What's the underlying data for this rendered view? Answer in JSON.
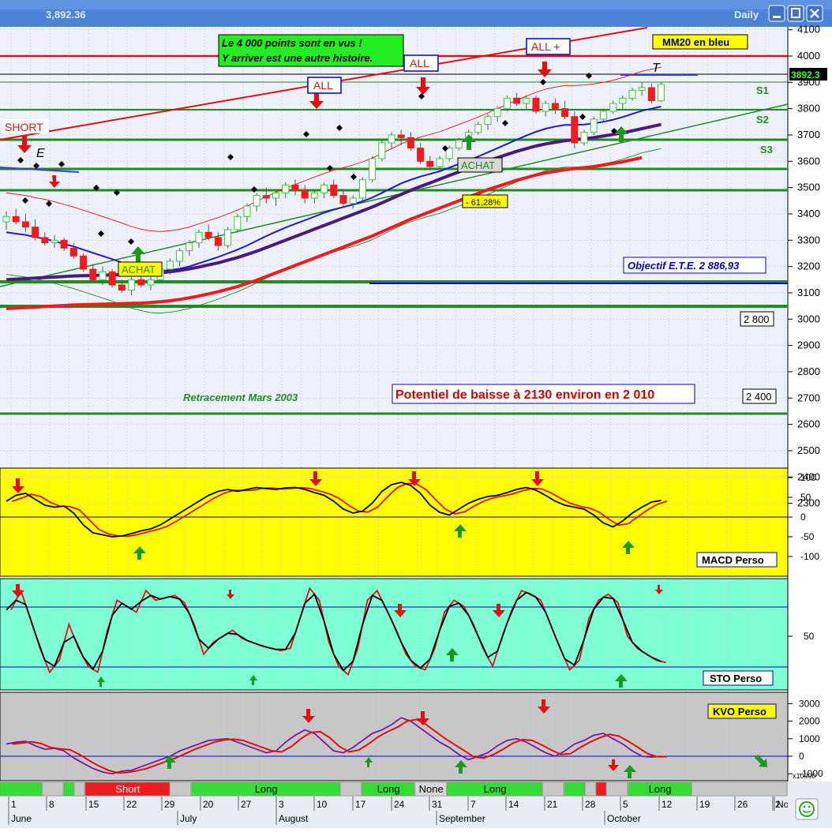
{
  "window": {
    "title_value": "3,892.36",
    "timeframe": "Daily",
    "buttons": [
      "minimize",
      "maximize",
      "close"
    ]
  },
  "price_panel": {
    "y_ticks": [
      4100,
      4000,
      3900,
      3800,
      3700,
      3600,
      3500,
      3400,
      3300,
      3200,
      3100,
      3000,
      2900,
      2800,
      2700,
      2600,
      2500,
      2400,
      2300
    ],
    "last_price": "3892.3",
    "annotations": {
      "headline_line1": "Le 4 000 points sont en vus !",
      "headline_line2": "Y arriver est une autre histoire.",
      "mm20": "MM20 en bleu",
      "all_1": "ALL",
      "all_2": "ALL",
      "all_plus": "ALL +",
      "short": "SHORT",
      "achat_1": "ACHAT",
      "achat_2": "ACHAT",
      "fib": "- 61,28%",
      "objectif": "Objectif E.T.E. 2 886,93",
      "retracement": "Retracement Mars 2003",
      "potentiel": "Potentiel de baisse à 2130 environ en 2 010",
      "label_2800": "2 800",
      "label_2400": "2 400",
      "s1": "S1",
      "s2": "S2",
      "s3": "S3",
      "e": "E",
      "t": "T"
    }
  },
  "macd_panel": {
    "name": "MACD Perso",
    "y_ticks": [
      100,
      50,
      0,
      -50,
      -100
    ]
  },
  "sto_panel": {
    "name": "STO Perso",
    "y_ticks": [
      50
    ]
  },
  "kvo_panel": {
    "name": "KVO Perso",
    "y_ticks": [
      3000,
      2000,
      1000,
      0,
      -1000
    ],
    "multiplier": "x10000"
  },
  "signal_strip": {
    "segments": [
      {
        "label": "",
        "color": "#33dd33",
        "start": 0,
        "end": 4
      },
      {
        "label": "",
        "color": "#c8c8c8",
        "start": 4,
        "end": 6
      },
      {
        "label": "",
        "color": "#33dd33",
        "start": 6,
        "end": 7
      },
      {
        "label": "",
        "color": "#c8c8c8",
        "start": 7,
        "end": 8
      },
      {
        "label": "Short",
        "color": "#ee1c1c",
        "start": 8,
        "end": 16
      },
      {
        "label": "",
        "color": "#c8c8c8",
        "start": 16,
        "end": 18
      },
      {
        "label": "Long",
        "color": "#33dd33",
        "start": 18,
        "end": 32
      },
      {
        "label": "",
        "color": "#c8c8c8",
        "start": 32,
        "end": 34
      },
      {
        "label": "Long",
        "color": "#33dd33",
        "start": 34,
        "end": 39
      },
      {
        "label": "None",
        "color": "#d8d8d8",
        "start": 39,
        "end": 42
      },
      {
        "label": "Long",
        "color": "#33dd33",
        "start": 42,
        "end": 51
      },
      {
        "label": "",
        "color": "#c8c8c8",
        "start": 51,
        "end": 53
      },
      {
        "label": "",
        "color": "#33dd33",
        "start": 53,
        "end": 55
      },
      {
        "label": "",
        "color": "#c8c8c8",
        "start": 55,
        "end": 56
      },
      {
        "label": "",
        "color": "#ee1c1c",
        "start": 56,
        "end": 57
      },
      {
        "label": "",
        "color": "#c8c8c8",
        "start": 57,
        "end": 59
      },
      {
        "label": "Long",
        "color": "#33dd33",
        "start": 59,
        "end": 65
      },
      {
        "label": "",
        "color": "#c8c8c8",
        "start": 65,
        "end": 74
      }
    ]
  },
  "x_axis": {
    "day_labels": [
      "1",
      "8",
      "15",
      "22",
      "29",
      "20",
      "27",
      "3",
      "10",
      "17",
      "24",
      "31",
      "7",
      "14",
      "21",
      "28",
      "5",
      "12",
      "19",
      "26",
      "2",
      "Nov"
    ],
    "month_labels": [
      "June",
      "July",
      "August",
      "September",
      "October"
    ]
  },
  "chart_data": {
    "type": "candlestick",
    "ylim": [
      2200,
      4150
    ],
    "ohlc": [
      [
        3370,
        3410,
        3340,
        3390
      ],
      [
        3390,
        3420,
        3360,
        3370
      ],
      [
        3370,
        3400,
        3330,
        3350
      ],
      [
        3350,
        3380,
        3300,
        3310
      ],
      [
        3310,
        3330,
        3280,
        3290
      ],
      [
        3290,
        3320,
        3270,
        3300
      ],
      [
        3300,
        3310,
        3260,
        3270
      ],
      [
        3270,
        3290,
        3230,
        3240
      ],
      [
        3240,
        3250,
        3180,
        3190
      ],
      [
        3190,
        3210,
        3140,
        3150
      ],
      [
        3150,
        3200,
        3130,
        3180
      ],
      [
        3180,
        3190,
        3120,
        3130
      ],
      [
        3130,
        3150,
        3100,
        3110
      ],
      [
        3110,
        3160,
        3090,
        3150
      ],
      [
        3150,
        3180,
        3120,
        3130
      ],
      [
        3130,
        3160,
        3110,
        3150
      ],
      [
        3150,
        3200,
        3140,
        3190
      ],
      [
        3190,
        3230,
        3170,
        3220
      ],
      [
        3220,
        3270,
        3200,
        3260
      ],
      [
        3260,
        3300,
        3240,
        3290
      ],
      [
        3290,
        3340,
        3270,
        3330
      ],
      [
        3330,
        3360,
        3300,
        3310
      ],
      [
        3310,
        3330,
        3260,
        3280
      ],
      [
        3280,
        3350,
        3270,
        3340
      ],
      [
        3340,
        3400,
        3330,
        3390
      ],
      [
        3390,
        3440,
        3370,
        3430
      ],
      [
        3430,
        3480,
        3410,
        3470
      ],
      [
        3470,
        3500,
        3440,
        3460
      ],
      [
        3460,
        3490,
        3430,
        3480
      ],
      [
        3480,
        3520,
        3460,
        3510
      ],
      [
        3510,
        3530,
        3470,
        3490
      ],
      [
        3490,
        3510,
        3440,
        3460
      ],
      [
        3460,
        3490,
        3440,
        3480
      ],
      [
        3480,
        3520,
        3460,
        3510
      ],
      [
        3510,
        3530,
        3460,
        3470
      ],
      [
        3470,
        3490,
        3430,
        3440
      ],
      [
        3440,
        3470,
        3420,
        3460
      ],
      [
        3460,
        3540,
        3450,
        3530
      ],
      [
        3530,
        3620,
        3520,
        3610
      ],
      [
        3610,
        3680,
        3600,
        3670
      ],
      [
        3670,
        3710,
        3650,
        3700
      ],
      [
        3700,
        3720,
        3660,
        3690
      ],
      [
        3690,
        3710,
        3640,
        3650
      ],
      [
        3650,
        3670,
        3590,
        3600
      ],
      [
        3600,
        3620,
        3570,
        3580
      ],
      [
        3580,
        3620,
        3570,
        3610
      ],
      [
        3610,
        3660,
        3600,
        3650
      ],
      [
        3650,
        3690,
        3640,
        3680
      ],
      [
        3680,
        3720,
        3660,
        3710
      ],
      [
        3710,
        3750,
        3700,
        3740
      ],
      [
        3740,
        3780,
        3720,
        3770
      ],
      [
        3770,
        3810,
        3750,
        3800
      ],
      [
        3800,
        3850,
        3790,
        3840
      ],
      [
        3840,
        3860,
        3810,
        3820
      ],
      [
        3820,
        3850,
        3800,
        3840
      ],
      [
        3840,
        3850,
        3780,
        3790
      ],
      [
        3790,
        3830,
        3770,
        3820
      ],
      [
        3820,
        3840,
        3780,
        3800
      ],
      [
        3800,
        3830,
        3760,
        3770
      ],
      [
        3770,
        3790,
        3650,
        3670
      ],
      [
        3670,
        3720,
        3660,
        3710
      ],
      [
        3710,
        3770,
        3700,
        3760
      ],
      [
        3760,
        3800,
        3750,
        3790
      ],
      [
        3790,
        3830,
        3780,
        3820
      ],
      [
        3820,
        3850,
        3800,
        3840
      ],
      [
        3840,
        3880,
        3830,
        3870
      ],
      [
        3870,
        3900,
        3850,
        3880
      ],
      [
        3880,
        3895,
        3820,
        3830
      ],
      [
        3830,
        3900,
        3825,
        3892
      ]
    ],
    "mm20": [
      3330,
      3325,
      3320,
      3312,
      3305,
      3296,
      3286,
      3276,
      3264,
      3252,
      3240,
      3228,
      3215,
      3202,
      3192,
      3185,
      3183,
      3186,
      3192,
      3200,
      3212,
      3224,
      3236,
      3250,
      3264,
      3280,
      3298,
      3316,
      3332,
      3348,
      3362,
      3376,
      3390,
      3404,
      3416,
      3426,
      3436,
      3448,
      3462,
      3480,
      3498,
      3516,
      3530,
      3542,
      3552,
      3562,
      3576,
      3590,
      3604,
      3618,
      3634,
      3650,
      3666,
      3682,
      3698,
      3712,
      3724,
      3732,
      3738,
      3738,
      3740,
      3744,
      3750,
      3758,
      3768,
      3780,
      3792,
      3800,
      3808
    ],
    "ma_slow": [
      3150,
      3152,
      3154,
      3156,
      3158,
      3160,
      3162,
      3164,
      3165,
      3166,
      3167,
      3168,
      3169,
      3170,
      3171,
      3173,
      3176,
      3180,
      3185,
      3191,
      3198,
      3206,
      3214,
      3224,
      3234,
      3246,
      3258,
      3272,
      3286,
      3300,
      3314,
      3328,
      3342,
      3356,
      3370,
      3384,
      3398,
      3412,
      3426,
      3442,
      3458,
      3474,
      3490,
      3504,
      3518,
      3532,
      3546,
      3560,
      3574,
      3588,
      3602,
      3614,
      3626,
      3638,
      3648,
      3658,
      3666,
      3672,
      3678,
      3682,
      3686,
      3690,
      3696,
      3702,
      3708,
      3716,
      3724,
      3732,
      3740
    ],
    "macd": [
      40,
      55,
      60,
      45,
      30,
      25,
      28,
      10,
      -20,
      -40,
      -45,
      -50,
      -48,
      -42,
      -35,
      -30,
      -20,
      -5,
      10,
      25,
      40,
      55,
      65,
      70,
      65,
      70,
      75,
      72,
      70,
      74,
      75,
      70,
      62,
      55,
      40,
      20,
      10,
      15,
      35,
      65,
      82,
      88,
      80,
      60,
      30,
      12,
      5,
      20,
      35,
      45,
      52,
      55,
      62,
      70,
      75,
      68,
      55,
      40,
      30,
      25,
      20,
      5,
      -15,
      -25,
      -10,
      10,
      25,
      38,
      42
    ],
    "sto": [
      72,
      88,
      65,
      40,
      20,
      30,
      60,
      40,
      25,
      20,
      55,
      80,
      75,
      70,
      88,
      80,
      82,
      84,
      78,
      60,
      35,
      45,
      50,
      55,
      48,
      45,
      42,
      40,
      38,
      40,
      65,
      90,
      80,
      45,
      25,
      18,
      40,
      80,
      88,
      72,
      55,
      35,
      25,
      22,
      40,
      70,
      80,
      75,
      60,
      40,
      25,
      50,
      72,
      88,
      85,
      80,
      60,
      40,
      22,
      30,
      65,
      80,
      85,
      78,
      50,
      40,
      35,
      30,
      28
    ],
    "kvo": [
      700,
      800,
      850,
      600,
      400,
      450,
      300,
      -100,
      -400,
      -700,
      -900,
      -1000,
      -850,
      -800,
      -600,
      -400,
      -200,
      0,
      300,
      500,
      700,
      900,
      950,
      1000,
      800,
      600,
      400,
      200,
      300,
      800,
      1200,
      1500,
      1300,
      800,
      300,
      200,
      500,
      900,
      1300,
      1500,
      1800,
      2200,
      2000,
      1600,
      1200,
      800,
      500,
      100,
      -200,
      0,
      200,
      600,
      900,
      1000,
      800,
      500,
      200,
      0,
      300,
      700,
      900,
      1200,
      1300,
      1000,
      700,
      300,
      0,
      -50,
      0
    ]
  }
}
